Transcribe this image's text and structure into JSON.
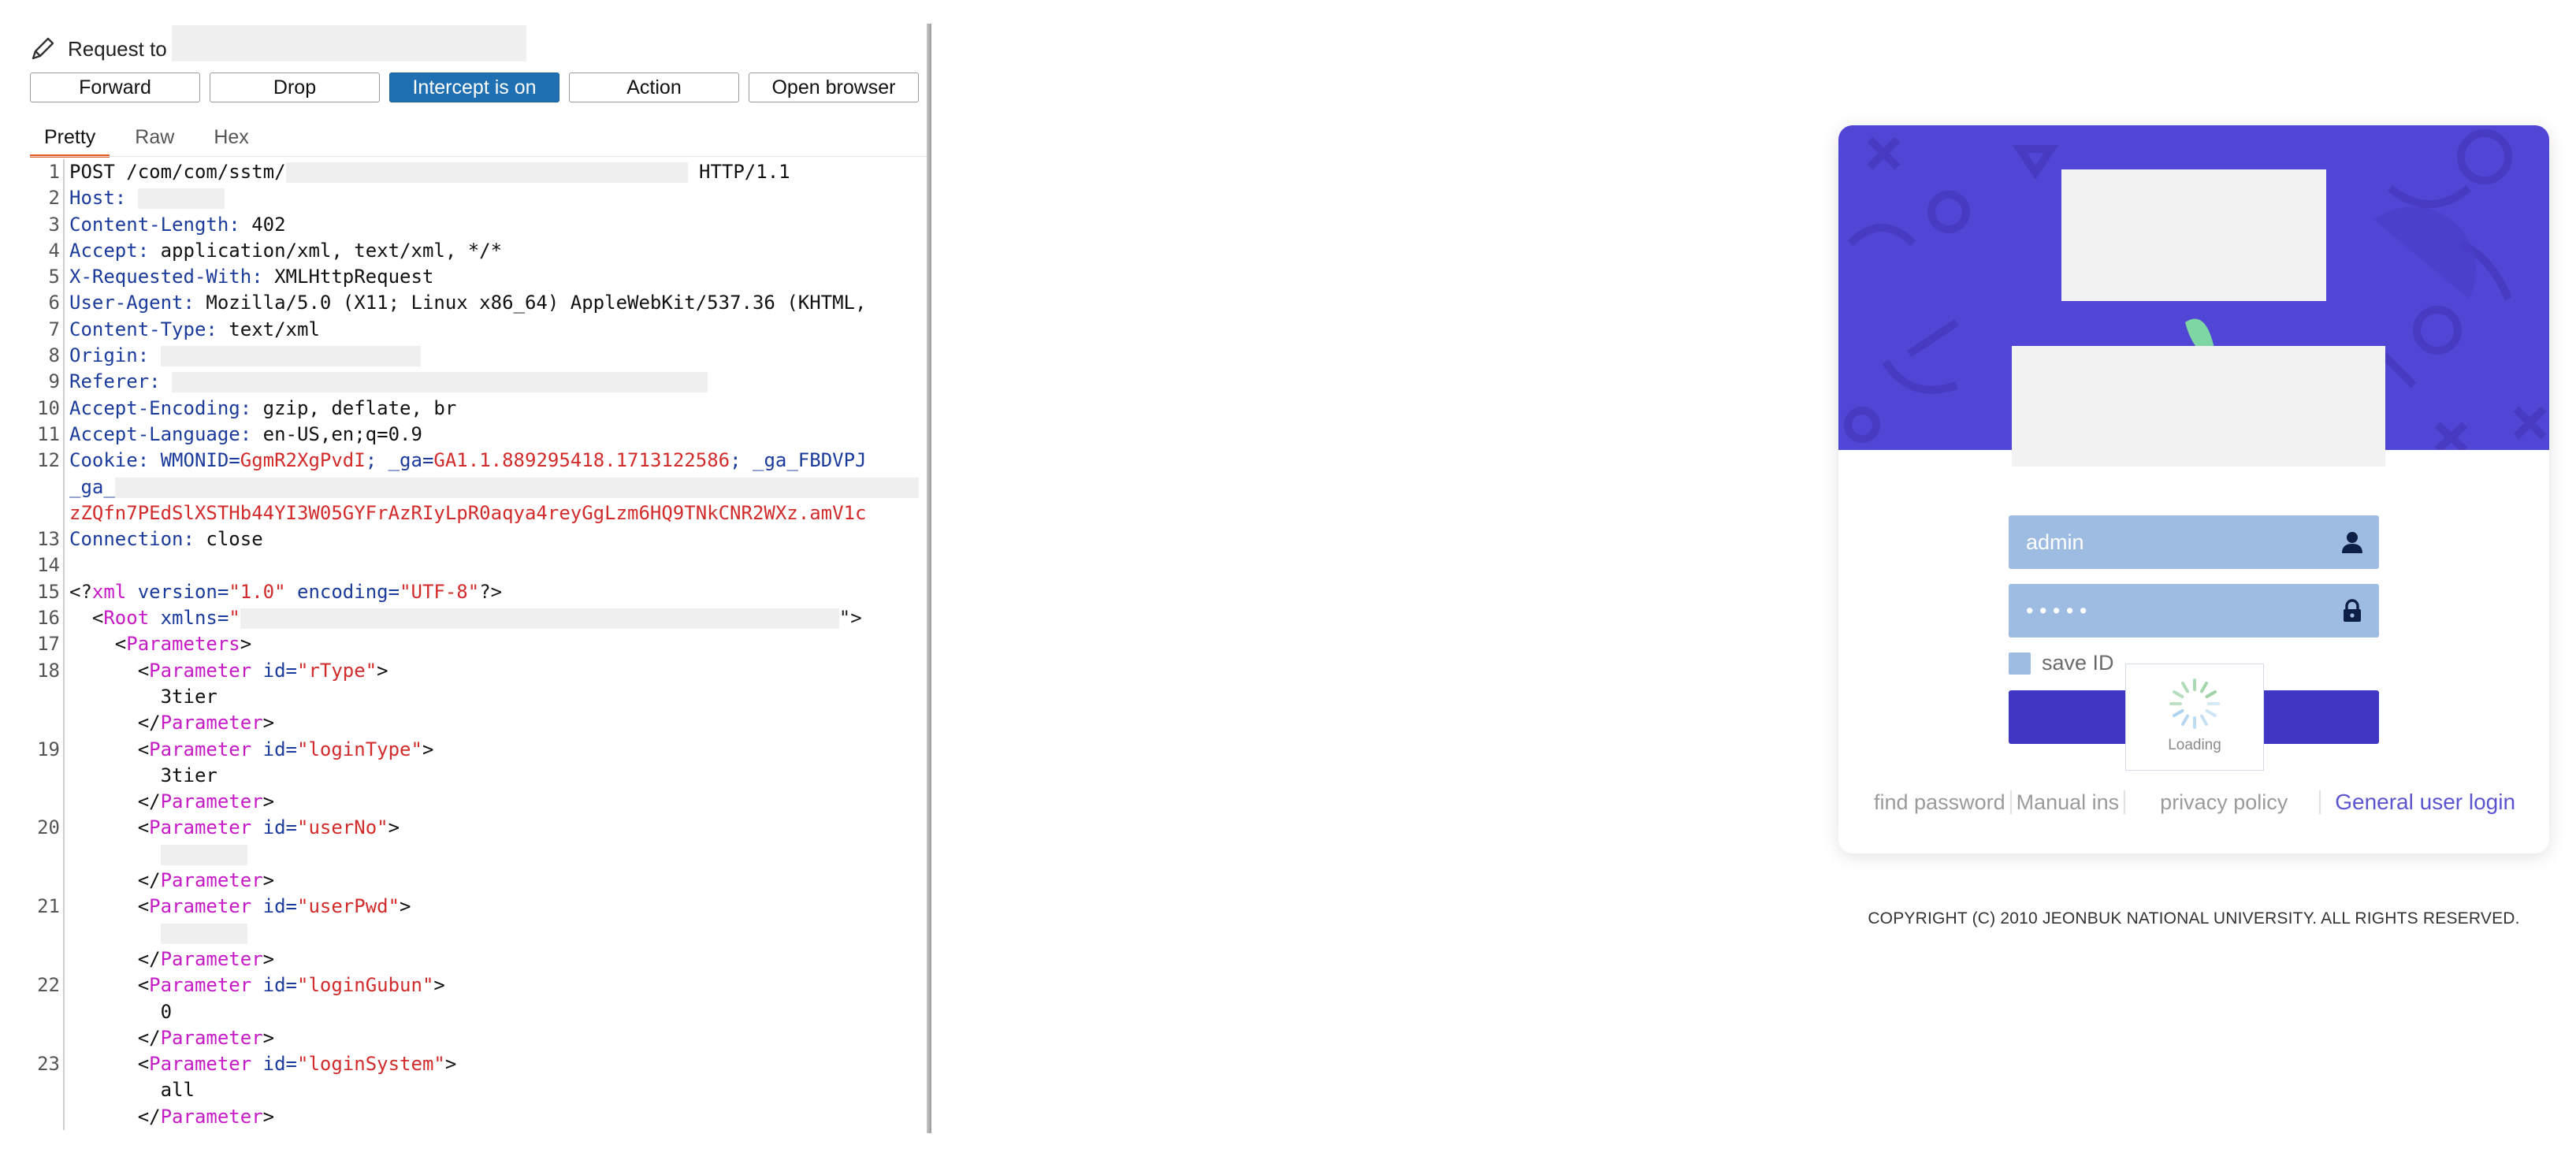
{
  "proxy": {
    "title": "Request to",
    "buttons": {
      "forward": "Forward",
      "drop": "Drop",
      "intercept": "Intercept is on",
      "action": "Action",
      "open_browser": "Open browser"
    },
    "tabs": [
      "Pretty",
      "Raw",
      "Hex"
    ],
    "line_numbers": [
      "1",
      "2",
      "3",
      "4",
      "5",
      "6",
      "7",
      "8",
      "9",
      "10",
      "11",
      "12",
      "",
      "",
      "13",
      "14",
      "15",
      "16",
      "17",
      "18",
      "",
      "",
      "19",
      "",
      "",
      "20",
      "",
      "",
      "21",
      "",
      "",
      "22",
      "",
      "",
      "23",
      "",
      ""
    ],
    "request": {
      "method_path": "POST /com/com/sstm/",
      "protocol": "HTTP/1.1",
      "host_key": "Host:",
      "content_length_key": "Content-Length:",
      "content_length_val": " 402",
      "accept_key": "Accept:",
      "accept_val": " application/xml, text/xml, */*",
      "xrw_key": "X-Requested-With:",
      "xrw_val": " XMLHttpRequest",
      "ua_key": "User-Agent:",
      "ua_val": " Mozilla/5.0 (X11; Linux x86_64) AppleWebKit/537.36 (KHTML,",
      "ctype_key": "Content-Type:",
      "ctype_val": " text/xml",
      "origin_key": "Origin:",
      "referer_key": "Referer:",
      "ae_key": "Accept-Encoding:",
      "ae_val": " gzip, deflate, br",
      "al_key": "Accept-Language:",
      "al_val": " en-US,en;q=0.9",
      "cookie_key": "Cookie:",
      "cookie_wm_key": " WMONID=",
      "cookie_wm_val": "GgmR2XgPvdI",
      "cookie_ga_key": "; _ga=",
      "cookie_ga_val": "GA1.1.889295418.1713122586",
      "cookie_ga2_key": "; _ga_FBDVPJ",
      "cookie_ga3_key": "_ga_",
      "cookie_token": "zZQfn7PEdSlXSTHb44YI3W05GYFrAzRIyLpR0aqya4reyGgLzm6HQ9TNkCNR2WXz.amV1c",
      "conn_key": "Connection:",
      "conn_val": " close"
    },
    "xml": {
      "decl_open": "<?",
      "decl_name": "xml",
      "version_attr": " version=",
      "version_val": "\"1.0\"",
      "encoding_attr": " encoding=",
      "encoding_val": "\"UTF-8\"",
      "decl_close": "?>",
      "root_open": "<",
      "root_tag": "Root",
      "root_attr": " xmlns=",
      "root_val_start": "\"",
      "root_close": "\">",
      "params_tag": "Parameters",
      "param_tag": "Parameter",
      "id_attr": " id=",
      "params": [
        {
          "id": "\"rType\"",
          "value": "3tier"
        },
        {
          "id": "\"loginType\"",
          "value": "3tier"
        },
        {
          "id": "\"userNo\"",
          "value": ""
        },
        {
          "id": "\"userPwd\"",
          "value": ""
        },
        {
          "id": "\"loginGubun\"",
          "value": "0"
        },
        {
          "id": "\"loginSystem\"",
          "value": "all"
        }
      ]
    }
  },
  "login": {
    "username_value": "admin",
    "password_value": "• • • • •",
    "save_id_label": "save ID",
    "loading_text": "Loading",
    "links": [
      "find password",
      "Manual ins",
      "privacy policy",
      "General user login"
    ],
    "copyright": "COPYRIGHT (C) 2010 JEONBUK NATIONAL UNIVERSITY. ALL RIGHTS RESERVED."
  },
  "colors": {
    "intercept_on": "#1f6fb3",
    "active_tab": "#e65a24",
    "banner": "#5145d6",
    "field": "#9ebbe1",
    "login_button": "#4136c4",
    "link_blue": "#5a55cf",
    "header_key": "#1b3b9c",
    "cookie_value": "#d22b2b",
    "xml_tag": "#c61ac6"
  },
  "icons": [
    "pencil-icon",
    "user-icon",
    "lock-icon",
    "spinner-icon"
  ]
}
